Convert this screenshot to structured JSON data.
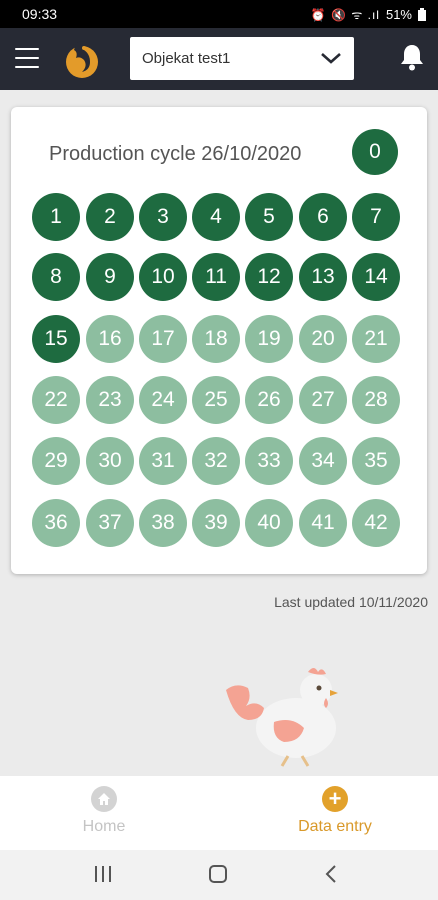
{
  "status_bar": {
    "time": "09:33",
    "icons": "⏰ 🔇 ᯤ .ıl",
    "battery": "51%"
  },
  "header": {
    "selected_object": "Objekat test1"
  },
  "cycle": {
    "title": "Production cycle 26/10/2020",
    "current_day": 15,
    "days": [
      0,
      1,
      2,
      3,
      4,
      5,
      6,
      7,
      8,
      9,
      10,
      11,
      12,
      13,
      14,
      15,
      16,
      17,
      18,
      19,
      20,
      21,
      22,
      23,
      24,
      25,
      26,
      27,
      28,
      29,
      30,
      31,
      32,
      33,
      34,
      35,
      36,
      37,
      38,
      39,
      40,
      41,
      42
    ]
  },
  "last_updated": "Last updated 10/11/2020",
  "bottom_nav": {
    "home": "Home",
    "data_entry": "Data entry"
  },
  "colors": {
    "done": "#1e6b40",
    "future": "#8dbea0",
    "accent": "#e2a12b",
    "header": "#272a34"
  }
}
